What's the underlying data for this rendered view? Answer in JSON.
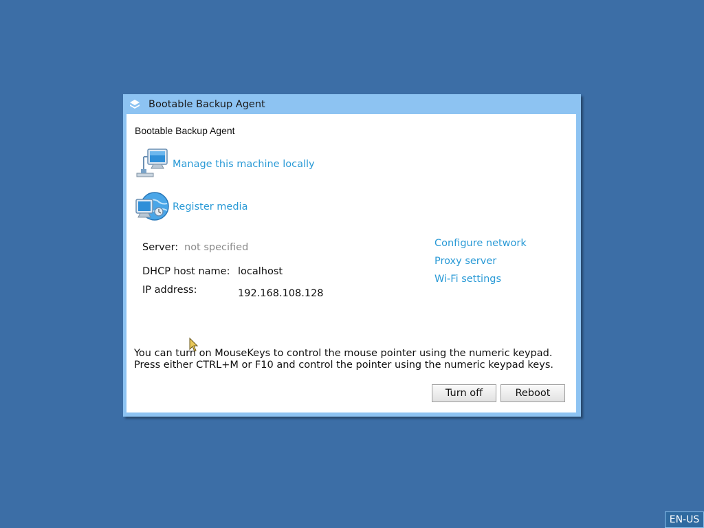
{
  "window": {
    "title": "Bootable Backup Agent"
  },
  "main": {
    "heading": "Bootable Backup Agent",
    "actions": [
      {
        "label": "Manage this machine locally",
        "icon": "computer-network-icon"
      },
      {
        "label": "Register media",
        "icon": "computer-globe-icon"
      }
    ],
    "info": {
      "server_label": "Server:",
      "server_value": "not specified",
      "dhcp_label": "DHCP host name:",
      "dhcp_value": "localhost",
      "ip_label": "IP address:",
      "ip_value": "192.168.108.128"
    },
    "links": [
      "Configure network",
      "Proxy server",
      "Wi-Fi settings"
    ],
    "note_line1": "You can turn on MouseKeys to control the mouse pointer using the numeric keypad.",
    "note_line2": "Press either CTRL+M or F10 and control the pointer using the numeric keypad keys.",
    "buttons": {
      "turn_off": "Turn off",
      "reboot": "Reboot"
    }
  },
  "taskbar": {
    "language": "EN-US"
  },
  "colors": {
    "desktop": "#3c6ea6",
    "titlebar": "#8dc3f2",
    "link": "#2a9ad6"
  }
}
